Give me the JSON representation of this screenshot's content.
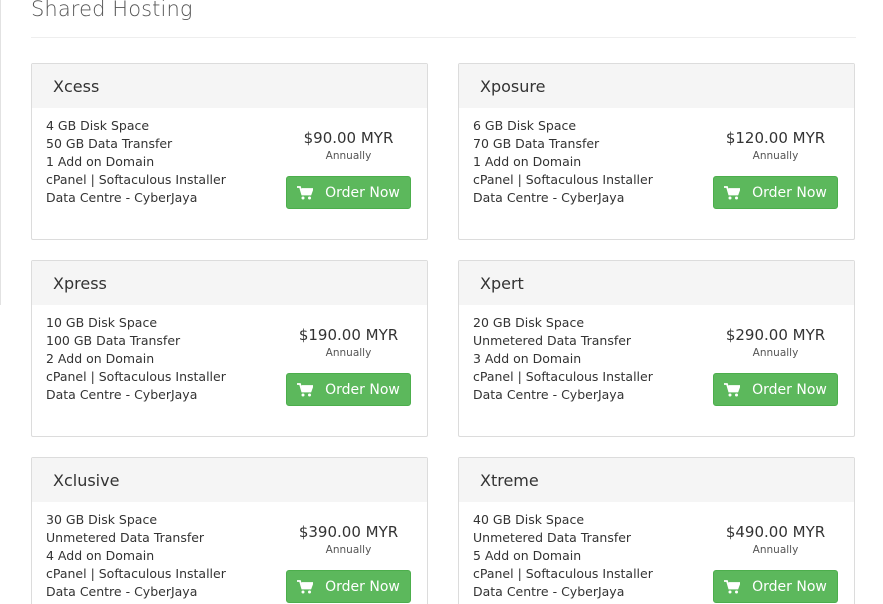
{
  "page": {
    "title": "Shared Hosting"
  },
  "colors": {
    "order_button": "#5cb85c",
    "card_header": "#f5f5f5"
  },
  "icons": {
    "order": "shopping-cart-icon"
  },
  "plans": [
    {
      "name": "Xcess",
      "features": [
        "4 GB Disk Space",
        "50 GB Data Transfer",
        "1 Add on Domain",
        "cPanel | Softaculous Installer",
        "Data Centre - CyberJaya"
      ],
      "price": "$90.00 MYR",
      "cycle": "Annually",
      "button": "Order Now"
    },
    {
      "name": "Xposure",
      "features": [
        "6 GB Disk Space",
        "70 GB Data Transfer",
        "1 Add on Domain",
        "cPanel | Softaculous Installer",
        "Data Centre - CyberJaya"
      ],
      "price": "$120.00 MYR",
      "cycle": "Annually",
      "button": "Order Now"
    },
    {
      "name": "Xpress",
      "features": [
        "10 GB Disk Space",
        "100 GB Data Transfer",
        "2 Add on Domain",
        "cPanel | Softaculous Installer",
        "Data Centre - CyberJaya"
      ],
      "price": "$190.00 MYR",
      "cycle": "Annually",
      "button": "Order Now"
    },
    {
      "name": "Xpert",
      "features": [
        "20 GB Disk Space",
        "Unmetered Data Transfer",
        "3 Add on Domain",
        "cPanel | Softaculous Installer",
        "Data Centre - CyberJaya"
      ],
      "price": "$290.00 MYR",
      "cycle": "Annually",
      "button": "Order Now"
    },
    {
      "name": "Xclusive",
      "features": [
        "30 GB Disk Space",
        "Unmetered Data Transfer",
        "4 Add on Domain",
        "cPanel | Softaculous Installer",
        "Data Centre - CyberJaya"
      ],
      "price": "$390.00 MYR",
      "cycle": "Annually",
      "button": "Order Now"
    },
    {
      "name": "Xtreme",
      "features": [
        "40 GB Disk Space",
        "Unmetered Data Transfer",
        "5 Add on Domain",
        "cPanel | Softaculous Installer",
        "Data Centre - CyberJaya"
      ],
      "price": "$490.00 MYR",
      "cycle": "Annually",
      "button": "Order Now"
    }
  ]
}
